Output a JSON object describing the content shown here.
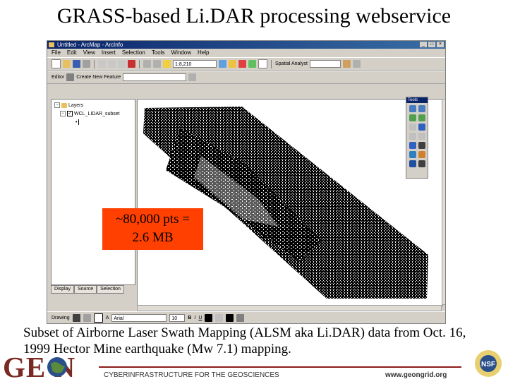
{
  "slide": {
    "title": "GRASS-based Li.DAR processing webservice",
    "callout_line1": "~80,000 pts =",
    "callout_line2": "2.6 MB",
    "caption_line1": "Subset of Airborne Laser Swath Mapping (ALSM aka Li.DAR) data from Oct. 16,",
    "caption_line2": "1999 Hector Mine earthquake (Mw 7.1) mapping.",
    "logo_text": "GE N",
    "footer_text": "CYBERINFRASTRUCTURE FOR THE GEOSCIENCES",
    "footer_url": "www.geongrid.org"
  },
  "app": {
    "window_title": "Untitled - ArcMap - ArcInfo",
    "menu": [
      "File",
      "Edit",
      "View",
      "Insert",
      "Selection",
      "Tools",
      "Window",
      "Help"
    ],
    "scale_value": "1:8,210",
    "spatial_analyst_label": "Spatial Analyst",
    "editor_label": "Editor",
    "task_label": "Create New Feature",
    "toc": {
      "layers_label": "Layers",
      "layer_name": "WCL_LIDAR_subset",
      "tabs": [
        "Display",
        "Source",
        "Selection"
      ]
    },
    "tools_title": "Tools",
    "drawing_label": "Drawing",
    "font_value": "Arial",
    "font_size_value": "10",
    "bold_label": "B",
    "italic_label": "I",
    "underline_label": "U",
    "text_tool_label": "A"
  },
  "colors": {
    "callout_bg": "#ff4000",
    "footer_line": "#8b1a1a",
    "logo_color": "#7a2a22",
    "titlebar": "#0a246a"
  }
}
